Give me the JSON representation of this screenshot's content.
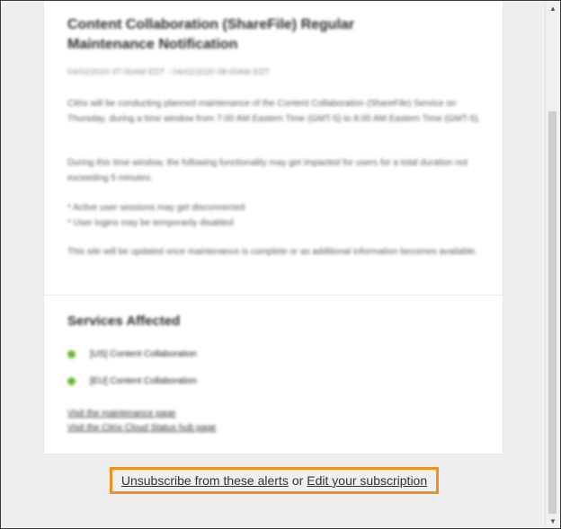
{
  "card": {
    "title": "Content Collaboration (ShareFile) Regular Maintenance Notification",
    "dates": "04/02/2020 07:00AM EDT - 04/02/2020 08:00AM EDT",
    "paragraphs": [
      "Citrix will be conducting planned maintenance of the Content Collaboration (ShareFile) Service on Thursday, during a time window from 7:00 AM Eastern Time (GMT-5) to 8:00 AM Eastern Time (GMT-5).",
      "During this time window, the following functionality may get impacted for users for a total duration not exceeding 5 minutes:",
      "* Active user sessions may get disconnected\n* User logins may be temporarily disabled",
      "This site will be updated once maintenance is complete or as additional information becomes available."
    ],
    "services_title": "Services Affected",
    "services": [
      {
        "label": "[US] Content Collaboration"
      },
      {
        "label": "[EU] Content Collaboration"
      }
    ],
    "links": [
      "Visit the maintenance page",
      "Visit the Citrix Cloud Status hub page"
    ]
  },
  "footer": {
    "unsubscribe": "Unsubscribe from these alerts",
    "or": "or",
    "edit": "Edit your subscription"
  },
  "colors": {
    "highlight_border": "#f0901e",
    "status_dot": "#6ab42d"
  },
  "icons": {
    "scroll_up": "up-arrow-icon",
    "scroll_down": "down-arrow-icon"
  }
}
